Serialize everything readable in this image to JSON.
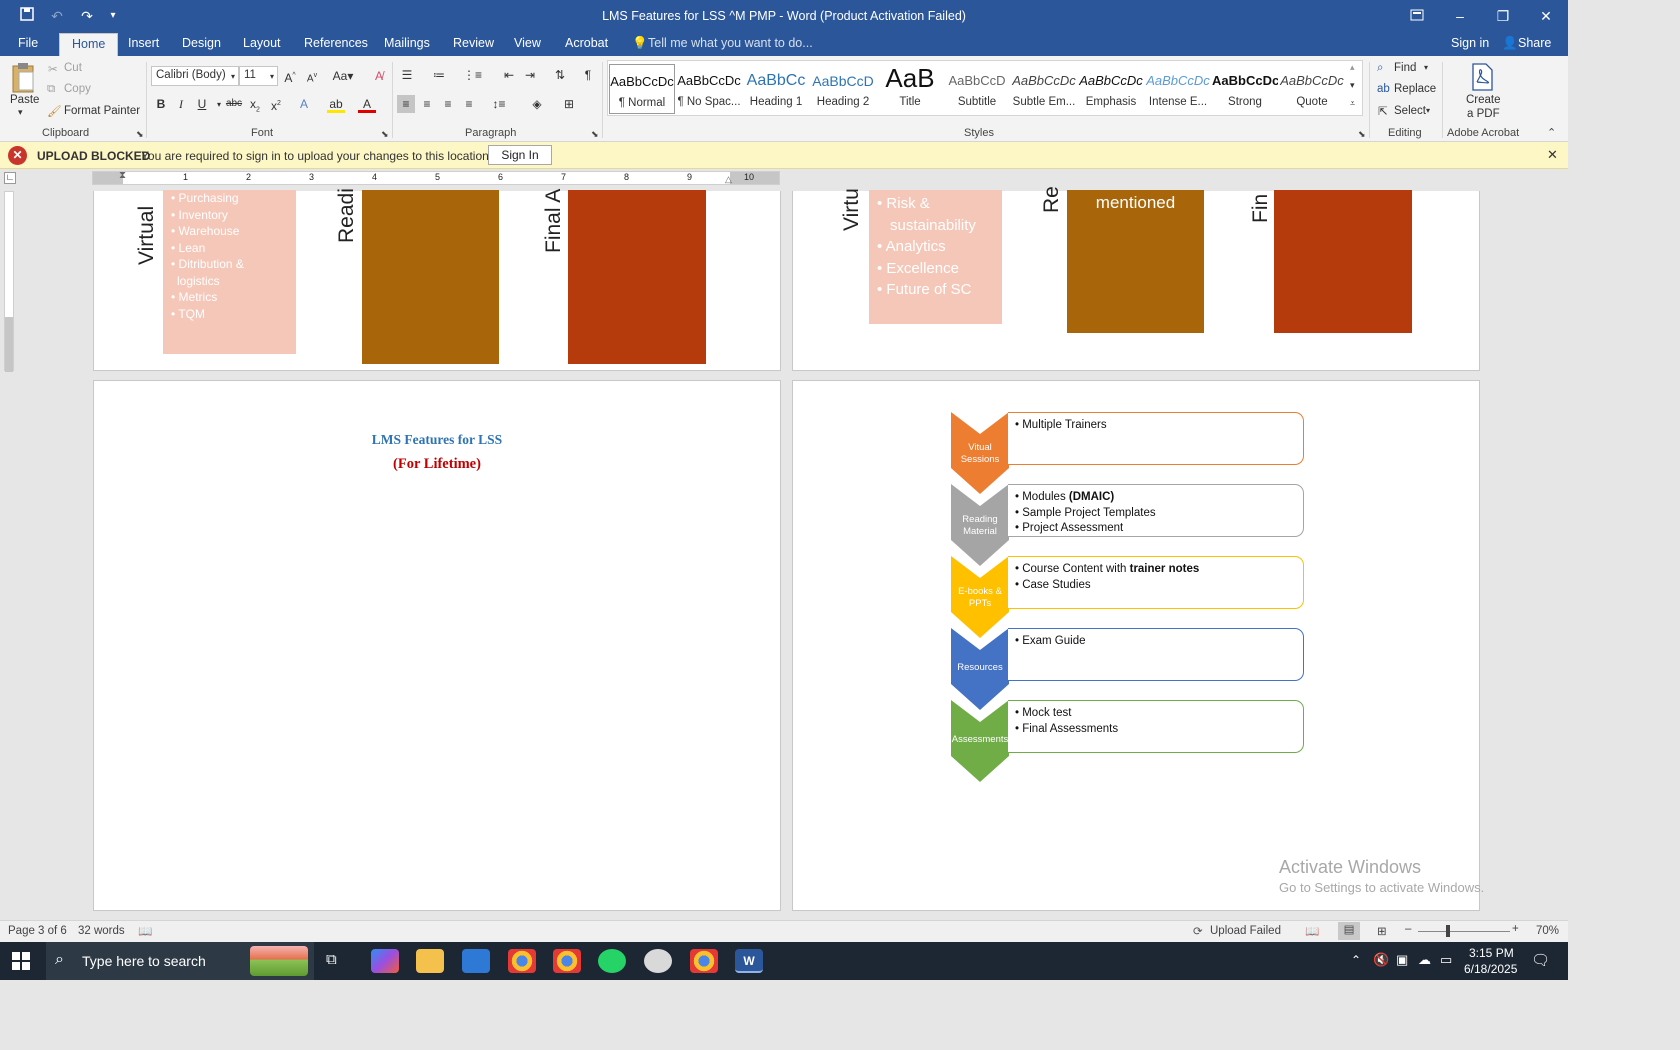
{
  "window": {
    "title": "LMS Features for LSS ^M PMP - Word (Product Activation Failed)"
  },
  "tabs": [
    "File",
    "Home",
    "Insert",
    "Design",
    "Layout",
    "References",
    "Mailings",
    "Review",
    "View",
    "Acrobat"
  ],
  "tell_me": "Tell me what you want to do...",
  "sign_in": "Sign in",
  "share": "Share",
  "clipboard": {
    "paste": "Paste",
    "cut": "Cut",
    "copy": "Copy",
    "format_painter": "Format Painter",
    "label": "Clipboard"
  },
  "font": {
    "name": "Calibri (Body)",
    "size": "11",
    "label": "Font"
  },
  "paragraph": {
    "label": "Paragraph"
  },
  "styles": {
    "label": "Styles",
    "items": [
      {
        "preview": "AaBbCcDc",
        "name": "¶ Normal"
      },
      {
        "preview": "AaBbCcDc",
        "name": "¶ No Spac..."
      },
      {
        "preview": "AaBbCc",
        "name": "Heading 1"
      },
      {
        "preview": "AaBbCcD",
        "name": "Heading 2"
      },
      {
        "preview": "AaB",
        "name": "Title"
      },
      {
        "preview": "AaBbCcD",
        "name": "Subtitle"
      },
      {
        "preview": "AaBbCcDc",
        "name": "Subtle Em..."
      },
      {
        "preview": "AaBbCcDc",
        "name": "Emphasis"
      },
      {
        "preview": "AaBbCcDc",
        "name": "Intense E..."
      },
      {
        "preview": "AaBbCcDc",
        "name": "Strong"
      },
      {
        "preview": "AaBbCcDc",
        "name": "Quote"
      }
    ]
  },
  "editing": {
    "find": "Find",
    "replace": "Replace",
    "select": "Select",
    "label": "Editing"
  },
  "acrobat_grp": {
    "create": "Create",
    "pdf": "a PDF",
    "label": "Adobe Acrobat"
  },
  "message": {
    "title": "UPLOAD BLOCKED",
    "text": "You are required to sign in to upload your changes to this location.",
    "button": "Sign In"
  },
  "ruler": [
    "1",
    "2",
    "3",
    "4",
    "5",
    "6",
    "7",
    "8",
    "9",
    "10"
  ],
  "page2_top": {
    "v1": "Virtual",
    "v2": "Readi",
    "v3": "Final A",
    "bullets": [
      "Purchasing",
      "Inventory",
      "Warehouse",
      "Lean",
      "Ditribution &",
      "logistics",
      "Metrics",
      "TQM"
    ]
  },
  "page3_top": {
    "v1": "Virtu",
    "v2": "Re",
    "v3": "Fin",
    "bullets": [
      "Risk &",
      "sustainability",
      "Analytics",
      "Excellence",
      "Future of SC"
    ],
    "mentioned": "mentioned"
  },
  "page_left": {
    "title": "LMS Features for LSS",
    "subtitle": "(For Lifetime)"
  },
  "diagram": [
    {
      "label": "Vitual Sessions",
      "lines": [
        "Multiple Trainers"
      ],
      "color": "#ed7d31"
    },
    {
      "label": "Reading Material",
      "lines": [
        "Modules <b>(DMAIC)</b>",
        "Sample Project Templates",
        "Project Assessment"
      ],
      "color": "#a5a5a5"
    },
    {
      "label": "E-books & PPTs",
      "lines": [
        "Course Content with <b>trainer notes</b>",
        "Case Studies"
      ],
      "color": "#ffc000"
    },
    {
      "label": "Resources",
      "lines": [
        "Exam Guide"
      ],
      "color": "#4472c4"
    },
    {
      "label": "Assessments",
      "lines": [
        "Mock test",
        "Final Assessments"
      ],
      "color": "#70ad47"
    }
  ],
  "activate": {
    "line1": "Activate Windows",
    "line2": "Go to Settings to activate Windows."
  },
  "status": {
    "page": "Page 3 of 6",
    "words": "32 words",
    "upload": "Upload Failed",
    "zoom": "70%"
  },
  "taskbar": {
    "search": "Type here to search",
    "time": "3:15 PM",
    "date": "6/18/2025"
  }
}
